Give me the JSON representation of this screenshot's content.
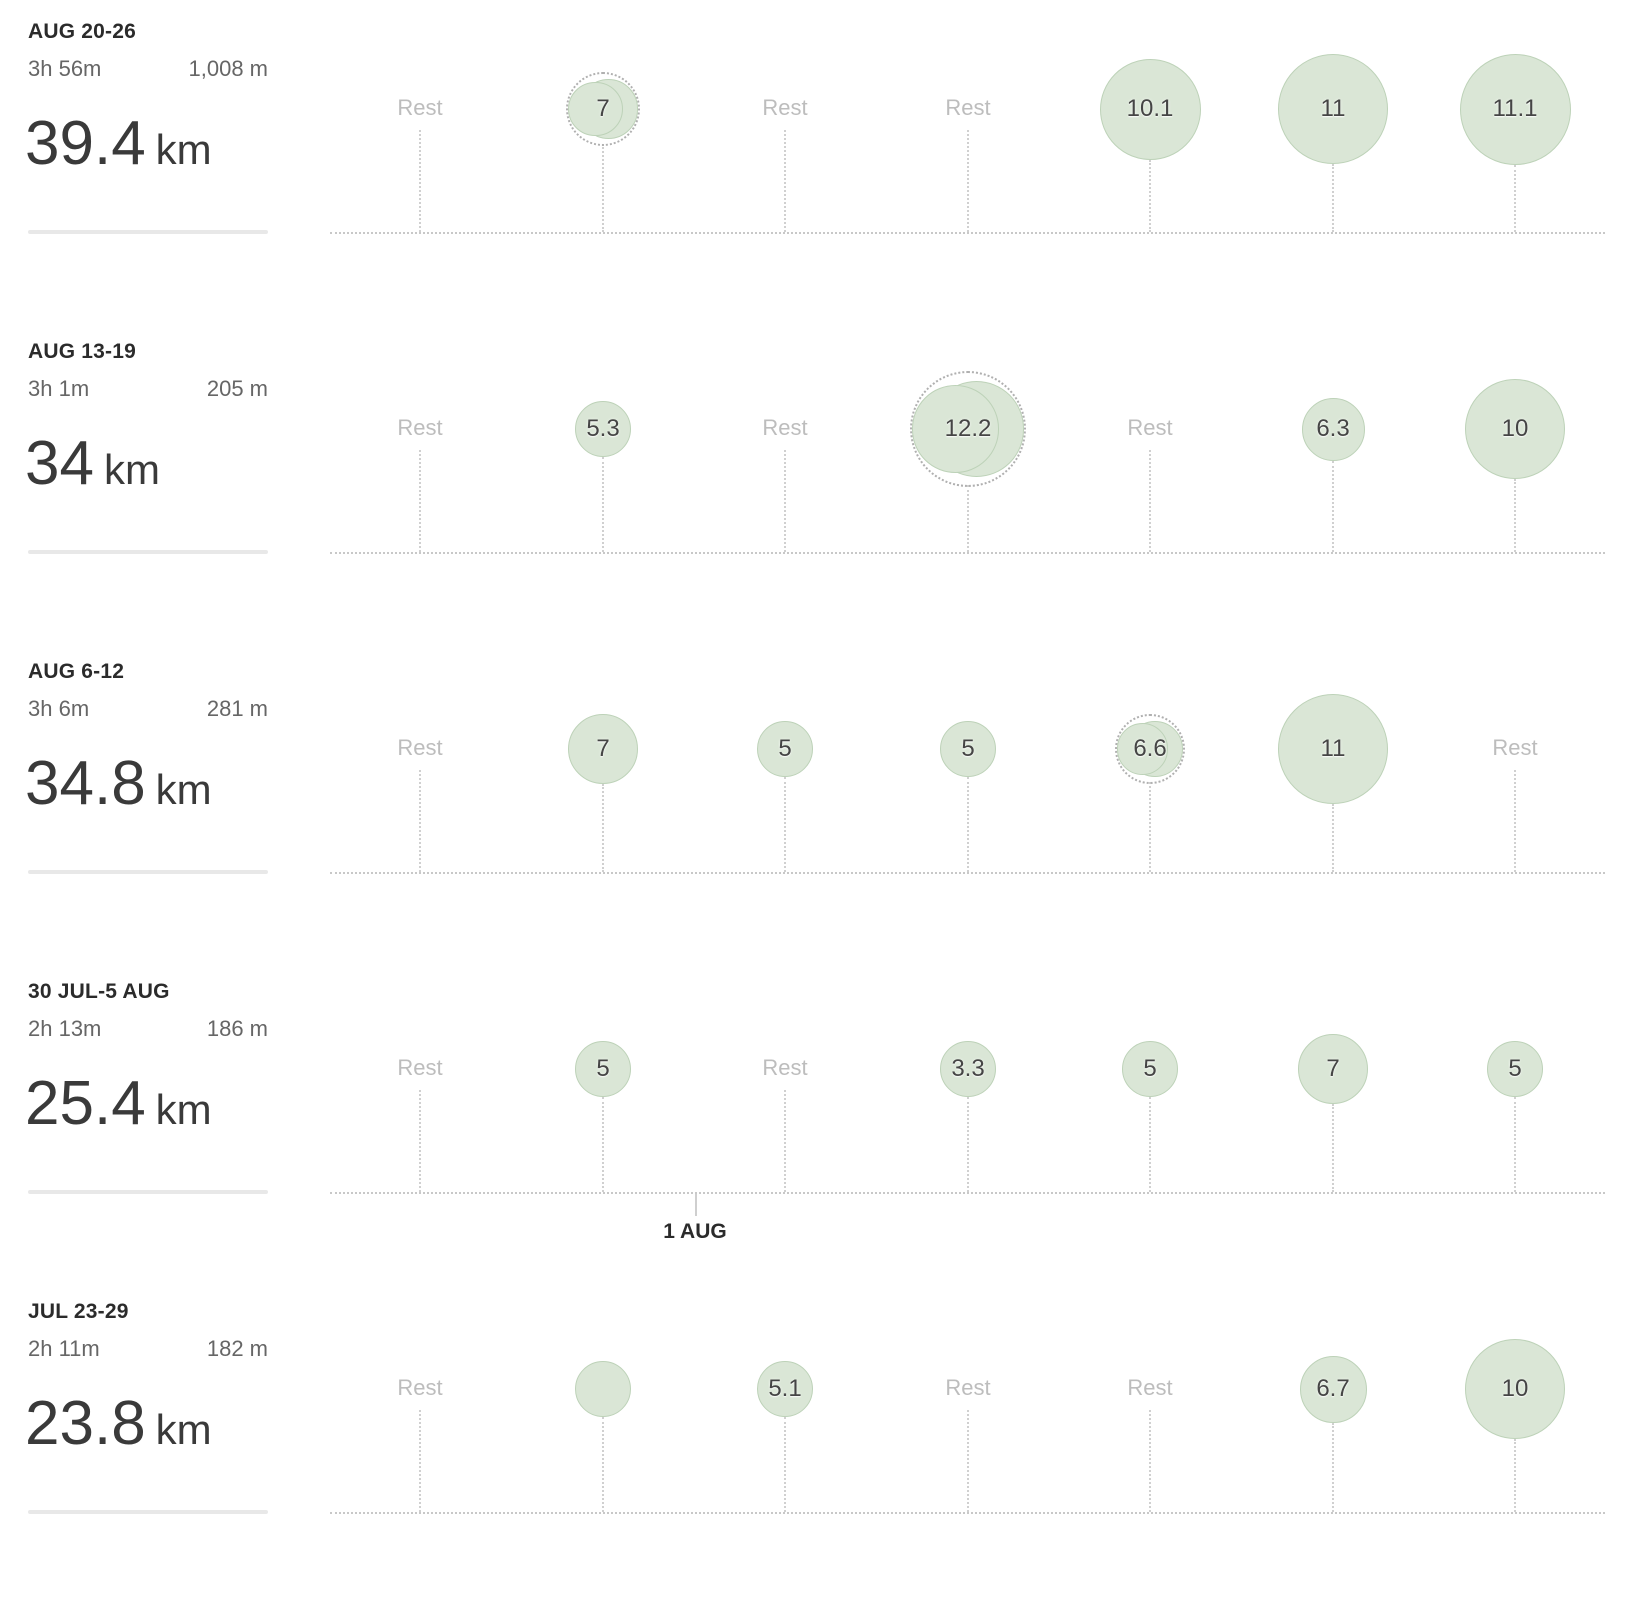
{
  "weeks": [
    {
      "title": "AUG 20-26",
      "time": "3h 56m",
      "elevation": "1,008 m",
      "distance": "39.4",
      "unit": "km",
      "days": [
        {
          "label": "Rest",
          "km": null,
          "multi": false
        },
        {
          "label": "7",
          "km": 7,
          "multi": true
        },
        {
          "label": "Rest",
          "km": null,
          "multi": false
        },
        {
          "label": "Rest",
          "km": null,
          "multi": false
        },
        {
          "label": "10.1",
          "km": 10.1,
          "multi": false
        },
        {
          "label": "11",
          "km": 11,
          "multi": false
        },
        {
          "label": "11.1",
          "km": 11.1,
          "multi": false
        }
      ]
    },
    {
      "title": "AUG 13-19",
      "time": "3h 1m",
      "elevation": "205 m",
      "distance": "34",
      "unit": "km",
      "days": [
        {
          "label": "Rest",
          "km": null,
          "multi": false
        },
        {
          "label": "5.3",
          "km": 5.3,
          "multi": false
        },
        {
          "label": "Rest",
          "km": null,
          "multi": false
        },
        {
          "label": "12.2",
          "km": 12.2,
          "multi": true
        },
        {
          "label": "Rest",
          "km": null,
          "multi": false
        },
        {
          "label": "6.3",
          "km": 6.3,
          "multi": false
        },
        {
          "label": "10",
          "km": 10,
          "multi": false
        }
      ]
    },
    {
      "title": "AUG 6-12",
      "time": "3h 6m",
      "elevation": "281 m",
      "distance": "34.8",
      "unit": "km",
      "days": [
        {
          "label": "Rest",
          "km": null,
          "multi": false
        },
        {
          "label": "7",
          "km": 7,
          "multi": false
        },
        {
          "label": "5",
          "km": 5,
          "multi": false
        },
        {
          "label": "5",
          "km": 5,
          "multi": false
        },
        {
          "label": "6.6",
          "km": 6.6,
          "multi": true
        },
        {
          "label": "11",
          "km": 11,
          "multi": false
        },
        {
          "label": "Rest",
          "km": null,
          "multi": false
        }
      ]
    },
    {
      "title": "30 JUL-5 AUG",
      "time": "2h 13m",
      "elevation": "186 m",
      "distance": "25.4",
      "unit": "km",
      "days": [
        {
          "label": "Rest",
          "km": null,
          "multi": false
        },
        {
          "label": "5",
          "km": 5,
          "multi": false
        },
        {
          "label": "Rest",
          "km": null,
          "multi": false
        },
        {
          "label": "3.3",
          "km": 3.3,
          "multi": false
        },
        {
          "label": "5",
          "km": 5,
          "multi": false
        },
        {
          "label": "7",
          "km": 7,
          "multi": false
        },
        {
          "label": "5",
          "km": 5,
          "multi": false
        }
      ]
    },
    {
      "title": "JUL 23-29",
      "time": "2h 11m",
      "elevation": "182 m",
      "distance": "23.8",
      "unit": "km",
      "days": [
        {
          "label": "Rest",
          "km": null,
          "multi": false
        },
        {
          "label": "",
          "km": 3.7,
          "multi": false
        },
        {
          "label": "5.1",
          "km": 5.1,
          "multi": false
        },
        {
          "label": "Rest",
          "km": null,
          "multi": false
        },
        {
          "label": "Rest",
          "km": null,
          "multi": false
        },
        {
          "label": "6.7",
          "km": 6.7,
          "multi": false
        },
        {
          "label": "10",
          "km": 10,
          "multi": false
        }
      ]
    }
  ],
  "month_marker": {
    "label": "1 AUG"
  },
  "colors": {
    "bubble_fill": "#dae6d6",
    "bubble_border": "#bdd2b8",
    "rest_text": "#bdbdbd"
  }
}
